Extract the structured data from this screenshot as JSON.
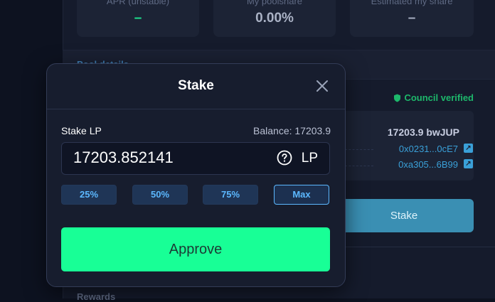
{
  "background": {
    "stats": [
      {
        "label": "APR (unstable)",
        "value": "–"
      },
      {
        "label": "My poolshare",
        "value": "0.00%"
      },
      {
        "label": "Estimated my share",
        "value": "–"
      }
    ],
    "pool_details_label": "Pool details",
    "council_verified": "Council verified",
    "token_amount": "17203.9 bwJUP",
    "addresses": [
      "0x0231...0cE7",
      "0xa305...6B99"
    ],
    "stake_button": "Stake",
    "rewards_label": "Rewards"
  },
  "modal": {
    "title": "Stake",
    "stake_label": "Stake LP",
    "balance": "Balance: 17203.9",
    "amount_value": "17203.852141",
    "unit": "LP",
    "percent_buttons": [
      "25%",
      "50%",
      "75%",
      "Max"
    ],
    "approve_button": "Approve"
  },
  "colors": {
    "accent_green": "#18ff96",
    "accent_blue": "#5cb8ff",
    "verified_green": "#1db86b"
  },
  "icons": [
    "close-icon",
    "help-icon",
    "shield-icon",
    "external-link-icon"
  ]
}
